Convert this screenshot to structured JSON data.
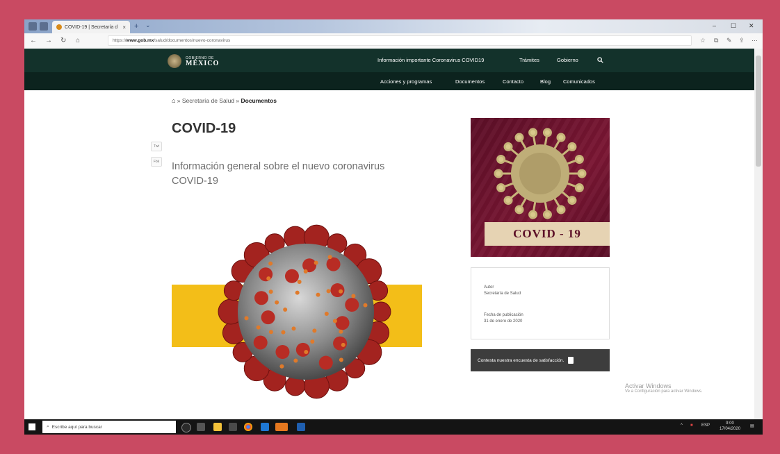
{
  "browser": {
    "tab_title": "COVID-19 | Secretaría d",
    "tab_close": "×",
    "new_tab": "+",
    "tab_menu": "⌄",
    "url_prefix": "https://",
    "url_domain": "www.gob.mx",
    "url_path": "/salud/documentos/nuevo-coronavirus",
    "back": "←",
    "forward": "→",
    "reload": "↻",
    "home": "⌂",
    "win_min": "–",
    "win_max": "☐",
    "win_close": "✕"
  },
  "site": {
    "logo_line1": "GOBIERNO DE",
    "logo_line2": "MÉXICO",
    "top_nav": [
      {
        "label": "Información importante Coronavirus COVID19"
      },
      {
        "label": "Trámites"
      },
      {
        "label": "Gobierno"
      }
    ],
    "search_icon": "search-icon",
    "sub_nav": [
      {
        "label": "Acciones y programas"
      },
      {
        "label": "Documentos"
      },
      {
        "label": "Contacto"
      },
      {
        "label": "Blog"
      },
      {
        "label": "Comunicados"
      }
    ]
  },
  "page": {
    "breadcrumb_sep": " » ",
    "breadcrumb": [
      "Secretaría de Salud",
      "Documentos"
    ],
    "title": "COVID-19",
    "share_buttons": [
      "Twt",
      "Fbk"
    ],
    "subtitle": "Información general sobre el nuevo coronavirus COVID-19",
    "side_image_label": "COVID - 19",
    "meta": {
      "author_label": "Autor",
      "author_value": "Secretaría de Salud",
      "date_label": "Fecha de publicación",
      "date_value": "31 de enero de 2020"
    },
    "survey_label": "Contesta nuestra encuesta de satisfacción."
  },
  "watermark": {
    "line1": "Activar Windows",
    "line2": "Ve a Configuración para activar Windows."
  },
  "taskbar": {
    "search_placeholder": "Escribe aquí para buscar",
    "tray_lang": "ESP",
    "tray_time": "9:00",
    "tray_date": "17/04/2020"
  }
}
